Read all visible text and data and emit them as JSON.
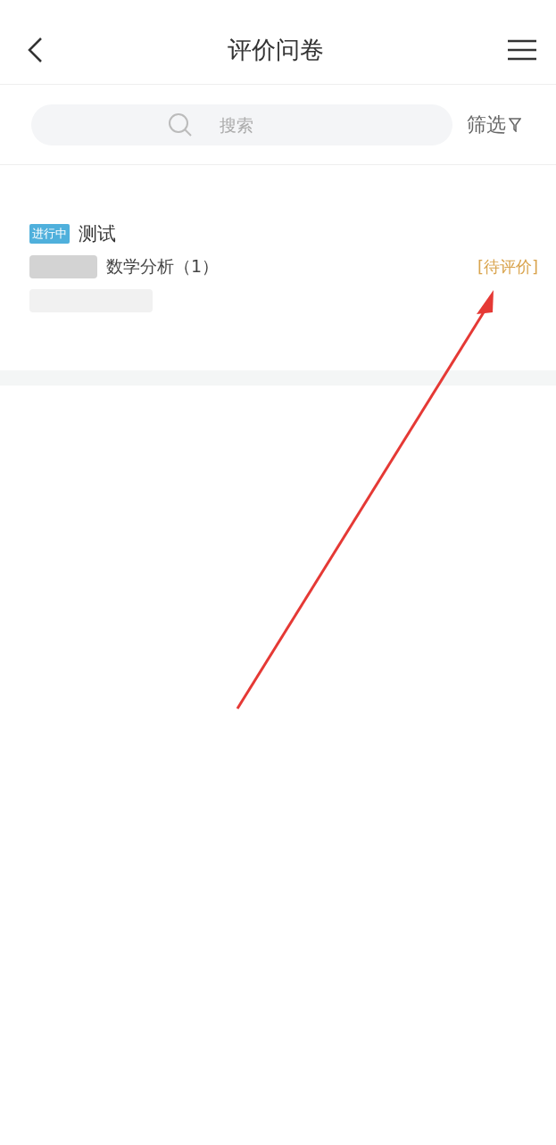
{
  "header": {
    "title": "评价问卷"
  },
  "search": {
    "placeholder": "搜索",
    "filter_label": "筛选"
  },
  "surveys": [
    {
      "status": "进行中",
      "title": "测试",
      "course": "数学分析（1）",
      "action": "[待评价]"
    }
  ]
}
